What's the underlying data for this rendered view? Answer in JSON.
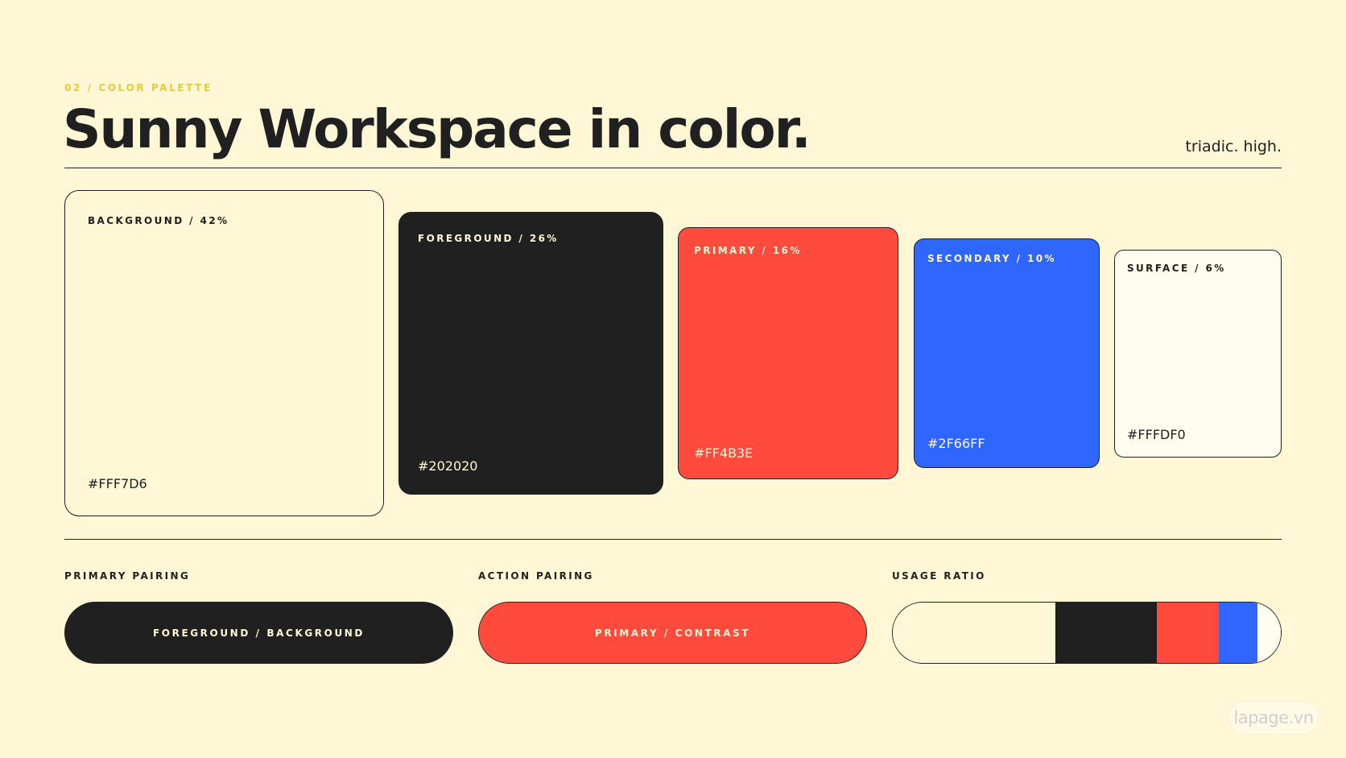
{
  "header": {
    "eyebrow": "02 / COLOR PALETTE",
    "title": "Sunny Workspace in color.",
    "tagline": "triadic. high."
  },
  "swatches": [
    {
      "label": "BACKGROUND / 42%",
      "hex": "#FFF7D6",
      "color": "#FFF7D6",
      "text_color": "#202020",
      "share": 42
    },
    {
      "label": "FOREGROUND / 26%",
      "hex": "#202020",
      "color": "#202020",
      "text_color": "#FFF7D6",
      "share": 26
    },
    {
      "label": "PRIMARY / 16%",
      "hex": "#FF4B3E",
      "color": "#FF4B3E",
      "text_color": "#FFF7D6",
      "share": 16
    },
    {
      "label": "SECONDARY / 10%",
      "hex": "#2F66FF",
      "color": "#2F66FF",
      "text_color": "#FFF7D6",
      "share": 10
    },
    {
      "label": "SURFACE / 6%",
      "hex": "#FFFDF0",
      "color": "#FFFDF0",
      "text_color": "#202020",
      "share": 6
    }
  ],
  "pairings": {
    "primary": {
      "label": "PRIMARY PAIRING",
      "pill": "FOREGROUND / BACKGROUND",
      "bg": "#202020",
      "fg": "#FFF7D6"
    },
    "action": {
      "label": "ACTION PAIRING",
      "pill": "PRIMARY / CONTRAST",
      "bg": "#FF4B3E",
      "fg": "#FFF7D6"
    },
    "usage": {
      "label": "USAGE RATIO"
    }
  },
  "colors": {
    "background": "#FFF7D6",
    "foreground": "#202020",
    "eyebrow": "#E8C93A"
  },
  "watermark": "lapage.vn"
}
